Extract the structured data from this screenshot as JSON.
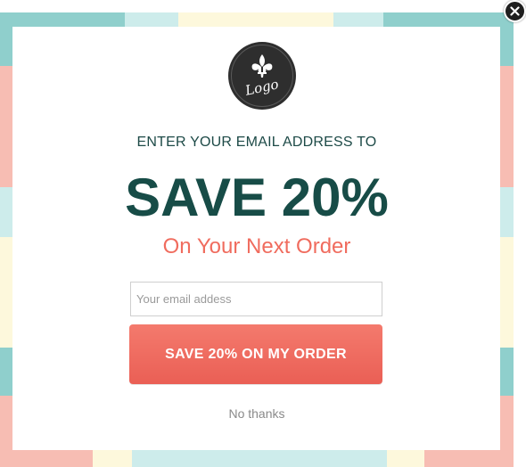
{
  "popup": {
    "logo_text": "Logo",
    "kicker": "ENTER YOUR EMAIL ADDRESS TO",
    "headline": "SAVE 20%",
    "subhead": "On Your Next Order",
    "email": {
      "placeholder": "Your email addess",
      "value": ""
    },
    "cta_label": "SAVE 20% ON MY ORDER",
    "decline_label": "No thanks"
  },
  "icons": {
    "close": "close-icon",
    "logo_emblem": "fleur-de-lis-icon"
  },
  "colors": {
    "teal": "#8fcfcc",
    "pale_teal": "#cdeceb",
    "cream": "#fdf8dc",
    "peach": "#f7bdb3",
    "headline": "#174c47",
    "accent": "#f06c5e",
    "button": "#ea5f55"
  }
}
